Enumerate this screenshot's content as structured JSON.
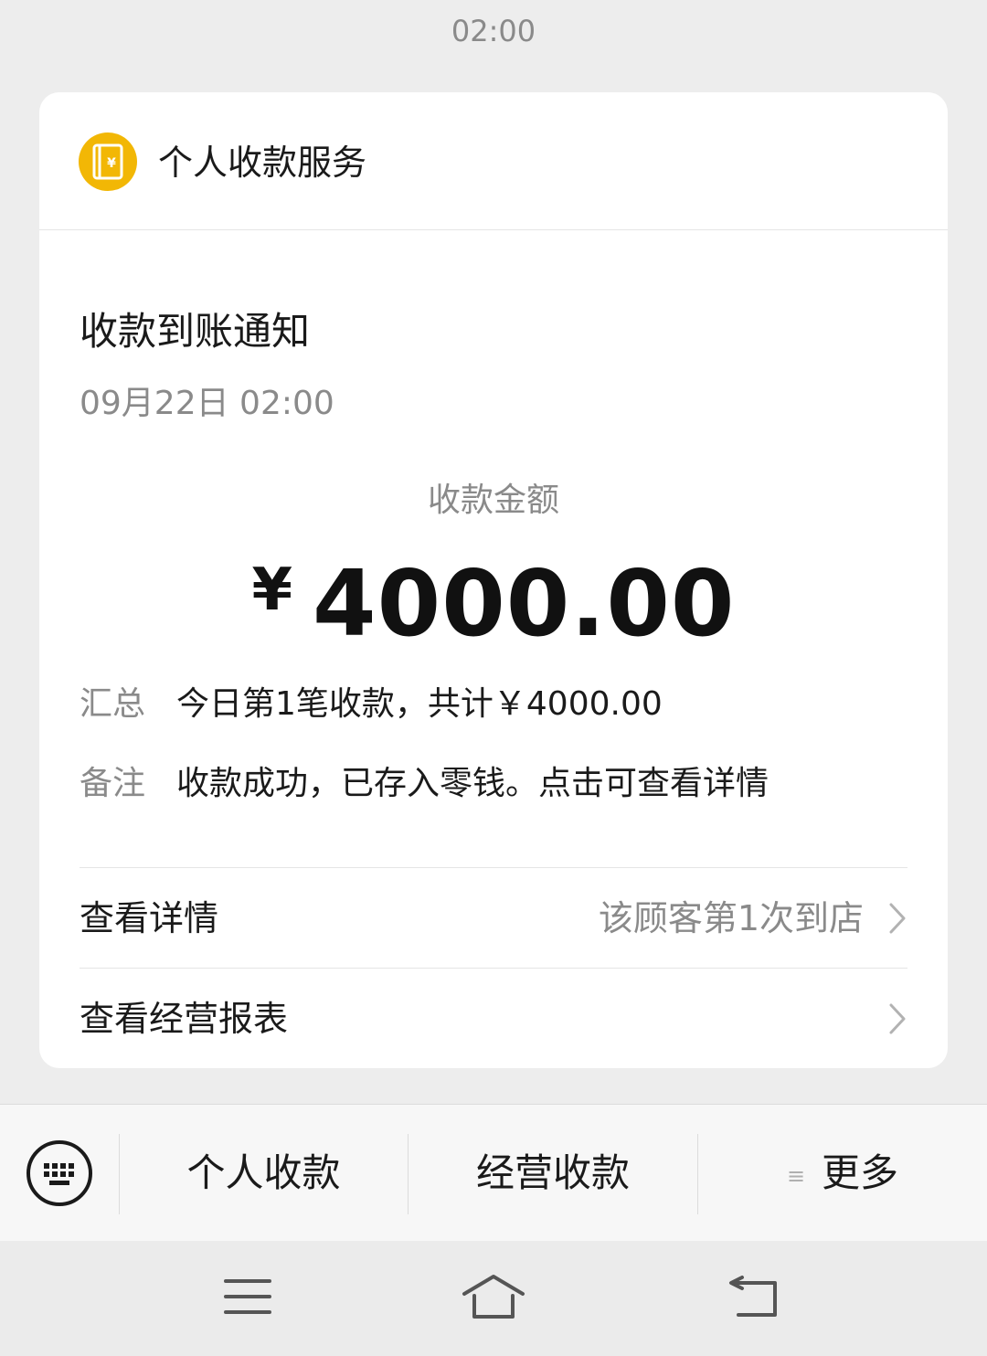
{
  "chat": {
    "time": "02:00"
  },
  "card": {
    "service_name": "个人收款服务",
    "service_icon": "wallet-yuan-icon",
    "accent_color": "#f2b705",
    "title": "收款到账通知",
    "date": "09月22日 02:00",
    "amount_label": "收款金额",
    "currency_symbol": "¥",
    "amount": "4000.00",
    "details": [
      {
        "key": "汇总",
        "value": "今日第1笔收款，共计￥4000.00"
      },
      {
        "key": "备注",
        "value": "收款成功，已存入零钱。点击可查看详情"
      }
    ],
    "links": [
      {
        "label": "查看详情",
        "hint": "该顾客第1次到店"
      },
      {
        "label": "查看经营报表",
        "hint": ""
      }
    ]
  },
  "bottom_menu": {
    "keyboard_icon": "keyboard-icon",
    "items": [
      {
        "label": "个人收款"
      },
      {
        "label": "经营收款"
      },
      {
        "label": "更多",
        "icon": "menu-lines-icon"
      }
    ]
  },
  "system_nav": {
    "buttons": [
      "menu-icon",
      "home-icon",
      "back-icon"
    ]
  }
}
